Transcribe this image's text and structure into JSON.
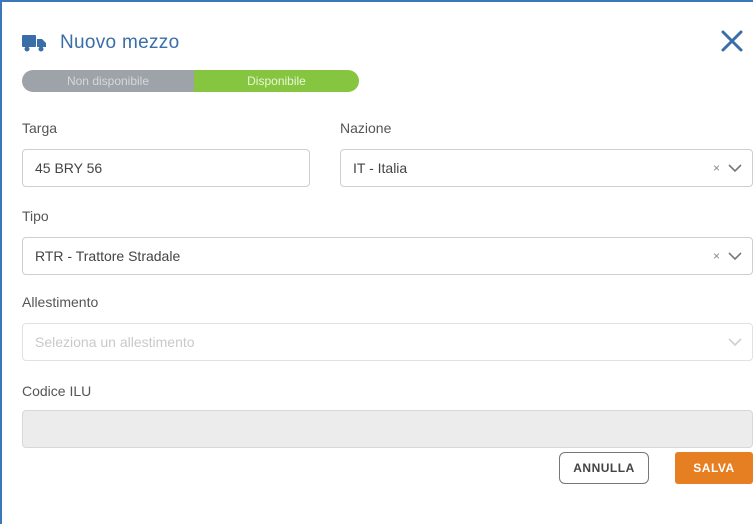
{
  "dialog": {
    "title": "Nuovo mezzo",
    "icon": "truck-icon",
    "accent_color": "#3a6ea8"
  },
  "availability_toggle": {
    "off_label": "Non disponibile",
    "on_label": "Disponibile",
    "selected": "Disponibile",
    "on_color": "#86c540",
    "off_color": "#9da3a8"
  },
  "form": {
    "targa": {
      "label": "Targa",
      "value": "45 BRY 56"
    },
    "nazione": {
      "label": "Nazione",
      "value": "IT - Italia"
    },
    "tipo": {
      "label": "Tipo",
      "value": "RTR - Trattore Stradale"
    },
    "allestimento": {
      "label": "Allestimento",
      "placeholder": "Seleziona un allestimento"
    },
    "codice_ilu": {
      "label": "Codice ILU",
      "value": ""
    }
  },
  "footer": {
    "cancel_label": "ANNULLA",
    "save_label": "SALVA",
    "save_color": "#e67e22"
  }
}
